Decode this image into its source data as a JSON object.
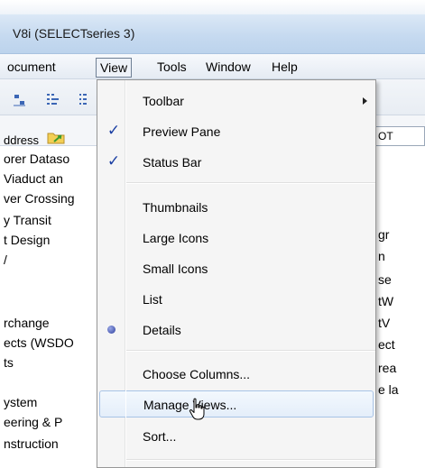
{
  "window": {
    "title": "V8i (SELECTseries 3)"
  },
  "menubar": {
    "items": [
      {
        "label": "ocument",
        "open": false
      },
      {
        "label": "View",
        "open": true
      },
      {
        "label": "Tools",
        "open": false
      },
      {
        "label": "Window",
        "open": false
      },
      {
        "label": "Help",
        "open": false
      }
    ]
  },
  "address": {
    "label": "ddress",
    "right_field": "OT"
  },
  "tree": {
    "items": [
      "orer Dataso",
      "Viaduct an",
      "ver Crossing",
      "y Transit",
      "t Design",
      "/",
      "rchange",
      "ects (WSDO",
      "ts",
      "ystem",
      "eering & P",
      "nstruction"
    ]
  },
  "right_pane": {
    "items": [
      "gr",
      "n",
      "se",
      "tW",
      "tV",
      "ect",
      "rea",
      "e la"
    ]
  },
  "view_menu": {
    "items": [
      {
        "label": "Toolbar",
        "submenu": true
      },
      {
        "label": "Preview Pane",
        "checked": true
      },
      {
        "label": "Status Bar",
        "checked": true
      },
      {
        "label": "Thumbnails"
      },
      {
        "label": "Large Icons"
      },
      {
        "label": "Small Icons"
      },
      {
        "label": "List"
      },
      {
        "label": "Details",
        "selected": true
      },
      {
        "label": "Choose Columns..."
      },
      {
        "label": "Manage Views...",
        "hovered": true
      },
      {
        "label": "Sort..."
      }
    ],
    "check_glyph": "✓"
  },
  "colors": {
    "title_bar": "#c6daf0",
    "menu_background": "#f5f5f5",
    "hover_border": "#a8c3e6",
    "check_color": "#1b3fa3"
  }
}
